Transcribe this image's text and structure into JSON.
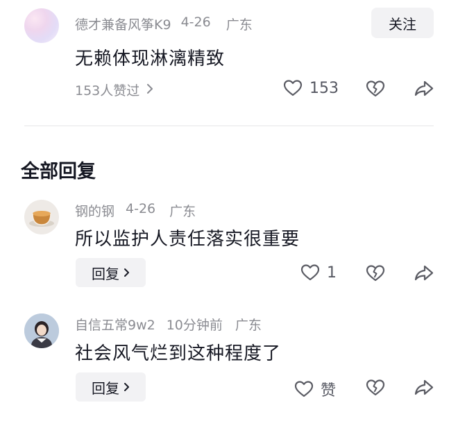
{
  "top_comment": {
    "username": "德才兼备风筝K9",
    "date": "4-26",
    "location": "广东",
    "follow_label": "关注",
    "text": "无赖体现淋漓精致",
    "likes_summary": "153人赞过",
    "like_count": "153"
  },
  "replies_section": {
    "title": "全部回复",
    "items": [
      {
        "username": "钢的钢",
        "date": "4-26",
        "location": "广东",
        "text": "所以监护人责任落实很重要",
        "reply_label": "回复",
        "like_count": "1"
      },
      {
        "username": "自信五常9w2",
        "date": "10分钟前",
        "location": "广东",
        "text": "社会风气烂到这种程度了",
        "reply_label": "回复",
        "like_count": "赞"
      }
    ]
  },
  "colors": {
    "text_primary": "#161823",
    "text_secondary": "#8a8b91",
    "button_bg": "#f2f2f4",
    "icon": "#5a5b63"
  },
  "icons": [
    "heart-icon",
    "broken-heart-icon",
    "share-icon",
    "chevron-right-icon"
  ]
}
